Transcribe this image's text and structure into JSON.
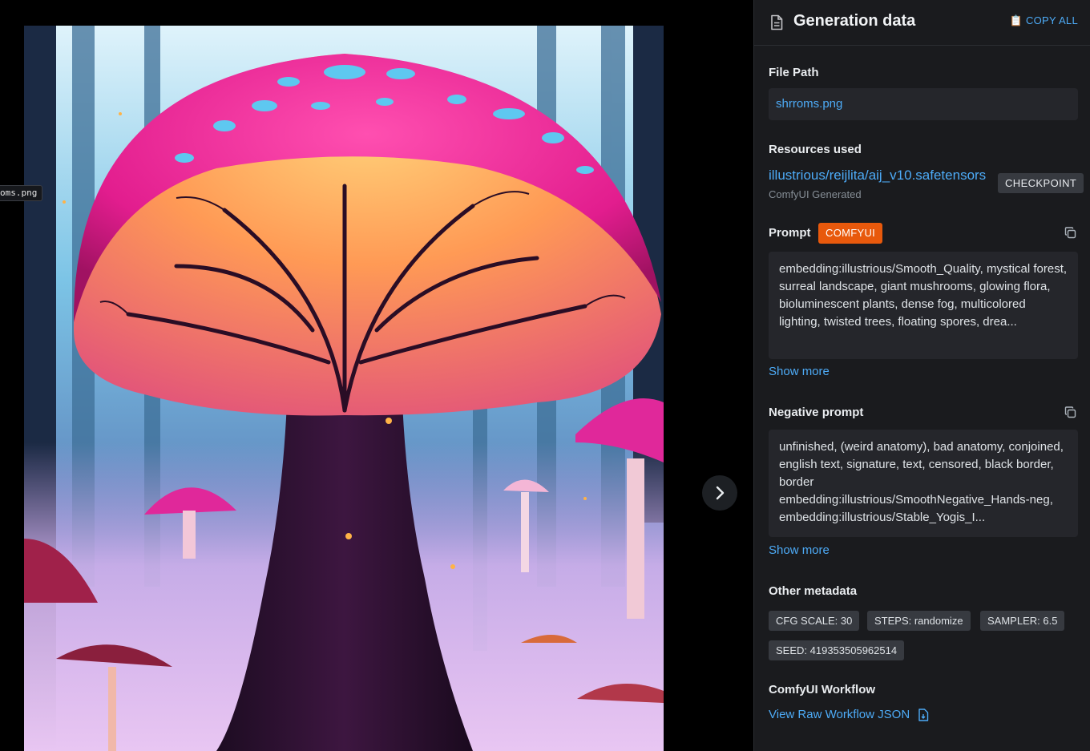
{
  "viewer": {
    "filename_tag": "oms.png",
    "next_icon": "chevron-right-icon"
  },
  "sidebar": {
    "title": "Generation data",
    "title_icon": "document-icon",
    "copy_all": "📋 COPY ALL",
    "file_path": {
      "label": "File Path",
      "value": "shrroms.png"
    },
    "resources": {
      "label": "Resources used",
      "name": "illustrious/reijlita/aij_v10.safetensors",
      "sub": "ComfyUI Generated",
      "badge": "CHECKPOINT"
    },
    "prompt": {
      "label": "Prompt",
      "badge": "COMFYUI",
      "text": "embedding:illustrious/Smooth_Quality, mystical forest, surreal landscape, giant mushrooms, glowing flora, bioluminescent plants, dense fog, multicolored lighting, twisted trees, floating spores, drea...",
      "show_more": "Show more"
    },
    "negative_prompt": {
      "label": "Negative prompt",
      "text": "unfinished, (weird anatomy), bad anatomy, conjoined, english text, signature, text, censored, black border, border embedding:illustrious/SmoothNegative_Hands-neg, embedding:illustrious/Stable_Yogis_I...",
      "show_more": "Show more"
    },
    "other_metadata": {
      "label": "Other metadata",
      "chips": [
        "CFG SCALE: 30",
        "STEPS: randomize",
        "SAMPLER: 6.5",
        "SEED: 419353505962514"
      ]
    },
    "workflow": {
      "label": "ComfyUI Workflow",
      "link": "View Raw Workflow JSON"
    }
  },
  "colors": {
    "accent": "#4dabf7",
    "badge_orange": "#e8590c",
    "panel": "#1a1b1e",
    "box": "#25262b",
    "chip": "#373a40"
  }
}
